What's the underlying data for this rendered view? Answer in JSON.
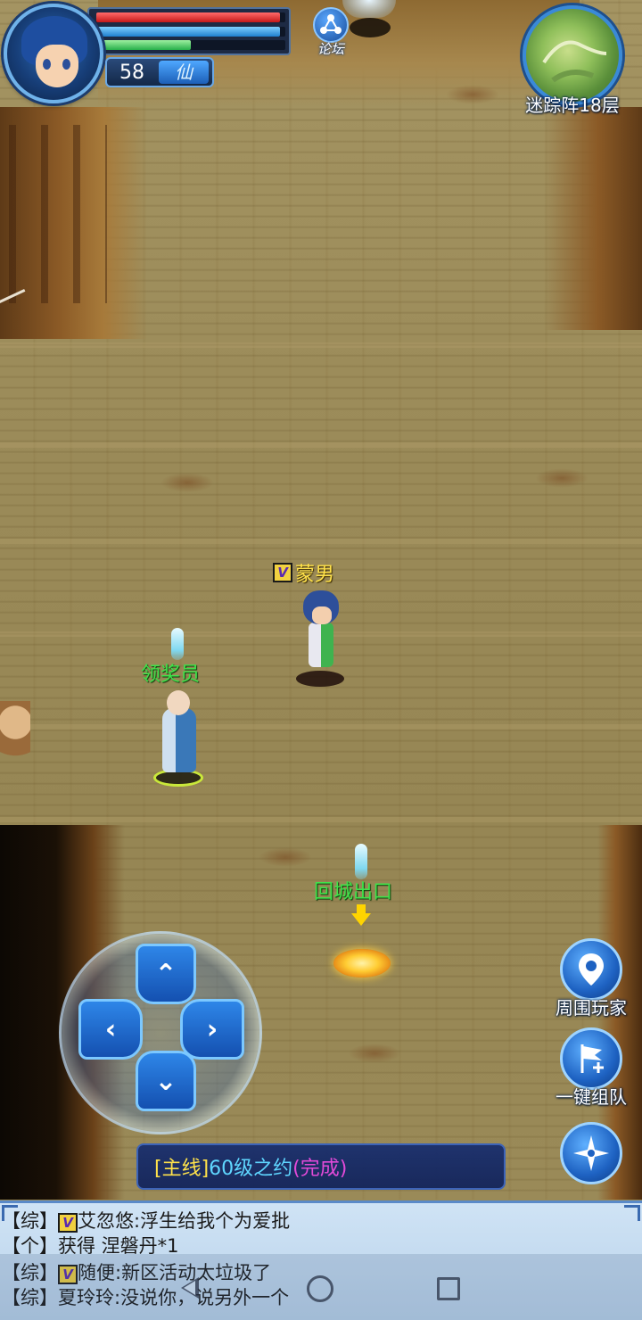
{
  "hud": {
    "level": "58",
    "class_tag": "仙",
    "hp_fraction": 0.97,
    "mp_fraction": 0.97,
    "xp_fraction": 0.5
  },
  "forum": {
    "label": "论坛",
    "icon": "forum-network-icon"
  },
  "minimap": {
    "location": "迷踪阵18层"
  },
  "player": {
    "vip": "V",
    "name": "蒙男"
  },
  "npcs": [
    {
      "name": "领奖员"
    },
    {
      "name": "回城出口"
    }
  ],
  "dpad": {
    "up": "⌃",
    "down": "⌄",
    "left": "‹",
    "right": "›"
  },
  "side_buttons": [
    {
      "label": "周围玩家",
      "icon": "location-pin-icon"
    },
    {
      "label": "一键组队",
      "icon": "flag-plus-icon"
    },
    {
      "label": "",
      "icon": "compass-star-icon"
    }
  ],
  "quest": {
    "tag": "[主线]",
    "name": "60级之约",
    "status": "(完成)"
  },
  "chat": [
    {
      "channel": "【综】",
      "vip": "V",
      "text": "艾忽悠:浮生给我个为爱批"
    },
    {
      "channel": "【个】",
      "vip": "",
      "text": "获得 涅磐丹*1"
    },
    {
      "channel": "【综】",
      "vip": "V",
      "text": "随便:新区活动太垃圾了"
    },
    {
      "channel": "【综】",
      "vip": "",
      "text": "夏玲玲:没说你，说另外一个"
    }
  ],
  "colors": {
    "npc_name": "#3fe24a",
    "player_name": "#ffe24a",
    "quest_tag": "#ffe24a",
    "quest_name": "#5fd6ff",
    "quest_status": "#e24ad8",
    "ui_blue": "#1e62c2"
  }
}
